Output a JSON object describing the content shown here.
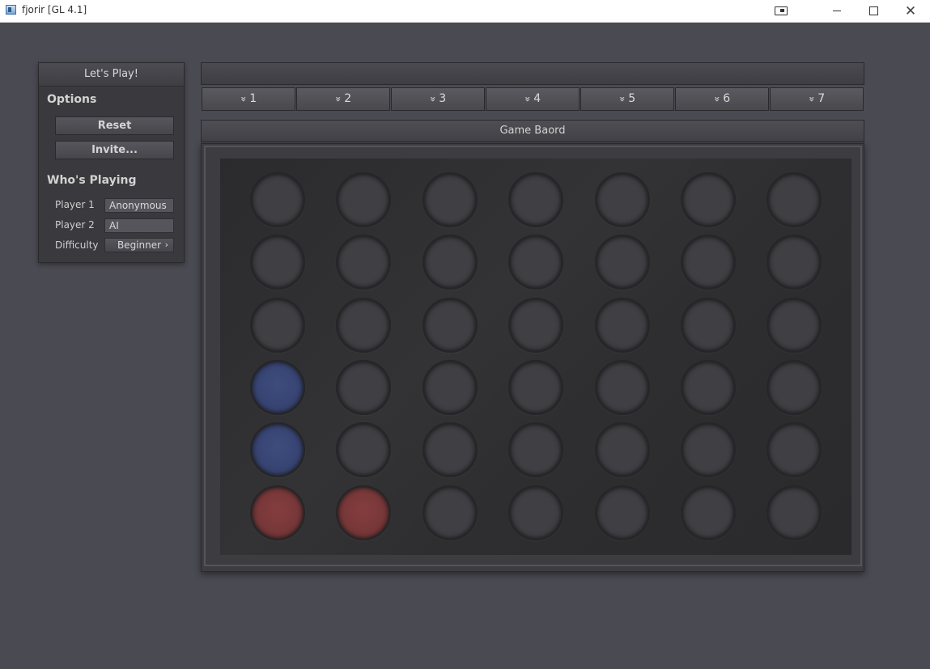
{
  "window": {
    "title": "fjorir [GL 4.1]",
    "controls": {
      "minimize": "minimize",
      "maximize": "maximize",
      "close": "✕"
    }
  },
  "left_panel": {
    "header": "Let's Play!",
    "options_title": "Options",
    "reset_label": "Reset",
    "invite_label": "Invite...",
    "players_title": "Who's Playing",
    "player1_label": "Player 1",
    "player1_value": "Anonymous",
    "player2_label": "Player 2",
    "player2_value": "AI",
    "difficulty_label": "Difficulty",
    "difficulty_value": "Beginner"
  },
  "columns": [
    "1",
    "2",
    "3",
    "4",
    "5",
    "6",
    "7"
  ],
  "column_icon": "double-chevron-down-icon",
  "board": {
    "title": "Game Baord",
    "rows": 6,
    "cols": 7,
    "cells": [
      [
        "empty",
        "empty",
        "empty",
        "empty",
        "empty",
        "empty",
        "empty"
      ],
      [
        "empty",
        "empty",
        "empty",
        "empty",
        "empty",
        "empty",
        "empty"
      ],
      [
        "empty",
        "empty",
        "empty",
        "empty",
        "empty",
        "empty",
        "empty"
      ],
      [
        "blue",
        "empty",
        "empty",
        "empty",
        "empty",
        "empty",
        "empty"
      ],
      [
        "blue",
        "empty",
        "empty",
        "empty",
        "empty",
        "empty",
        "empty"
      ],
      [
        "red",
        "red",
        "empty",
        "empty",
        "empty",
        "empty",
        "empty"
      ]
    ]
  },
  "colors": {
    "background": "#4a4a52",
    "blue_piece": "#35426f",
    "red_piece": "#733536",
    "empty_slot": "#3f3f44"
  }
}
